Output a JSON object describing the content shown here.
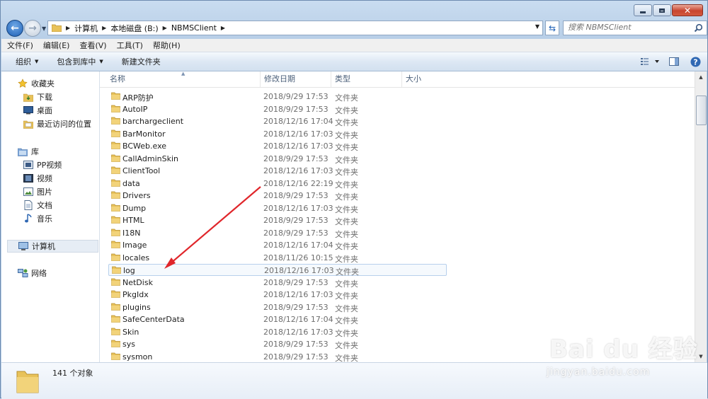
{
  "window": {
    "caption_buttons": [
      "minimize",
      "maximize",
      "close"
    ]
  },
  "address_bar": {
    "breadcrumbs": [
      "计算机",
      "本地磁盘 (B:)",
      "NBMSClient"
    ],
    "search_placeholder": "搜索 NBMSClient"
  },
  "menu_bar": {
    "items": [
      "文件(F)",
      "编辑(E)",
      "查看(V)",
      "工具(T)",
      "帮助(H)"
    ]
  },
  "command_bar": {
    "organize": "组织",
    "include_in_library": "包含到库中",
    "new_folder": "新建文件夹"
  },
  "nav_pane": {
    "favorites": {
      "label": "收藏夹",
      "items": [
        "下载",
        "桌面",
        "最近访问的位置"
      ]
    },
    "libraries": {
      "label": "库",
      "items": [
        "PP视频",
        "视频",
        "图片",
        "文档",
        "音乐"
      ]
    },
    "computer": "计算机",
    "network": "网络"
  },
  "file_list": {
    "columns": [
      "名称",
      "修改日期",
      "类型",
      "大小"
    ],
    "rows": [
      {
        "name": "ARP防护",
        "date": "2018/9/29 17:53",
        "type": "文件夹"
      },
      {
        "name": "AutoIP",
        "date": "2018/9/29 17:53",
        "type": "文件夹"
      },
      {
        "name": "barchargeclient",
        "date": "2018/12/16 17:04",
        "type": "文件夹"
      },
      {
        "name": "BarMonitor",
        "date": "2018/12/16 17:03",
        "type": "文件夹"
      },
      {
        "name": "BCWeb.exe",
        "date": "2018/12/16 17:03",
        "type": "文件夹"
      },
      {
        "name": "CallAdminSkin",
        "date": "2018/9/29 17:53",
        "type": "文件夹"
      },
      {
        "name": "ClientTool",
        "date": "2018/12/16 17:03",
        "type": "文件夹"
      },
      {
        "name": "data",
        "date": "2018/12/16 22:19",
        "type": "文件夹"
      },
      {
        "name": "Drivers",
        "date": "2018/9/29 17:53",
        "type": "文件夹"
      },
      {
        "name": "Dump",
        "date": "2018/12/16 17:03",
        "type": "文件夹"
      },
      {
        "name": "HTML",
        "date": "2018/9/29 17:53",
        "type": "文件夹"
      },
      {
        "name": "I18N",
        "date": "2018/9/29 17:53",
        "type": "文件夹"
      },
      {
        "name": "Image",
        "date": "2018/12/16 17:04",
        "type": "文件夹"
      },
      {
        "name": "locales",
        "date": "2018/11/26 10:15",
        "type": "文件夹"
      },
      {
        "name": "log",
        "date": "2018/12/16 17:03",
        "type": "文件夹"
      },
      {
        "name": "NetDisk",
        "date": "2018/9/29 17:53",
        "type": "文件夹"
      },
      {
        "name": "PkgIdx",
        "date": "2018/12/16 17:03",
        "type": "文件夹"
      },
      {
        "name": "plugins",
        "date": "2018/9/29 17:53",
        "type": "文件夹"
      },
      {
        "name": "SafeCenterData",
        "date": "2018/12/16 17:04",
        "type": "文件夹"
      },
      {
        "name": "Skin",
        "date": "2018/12/16 17:03",
        "type": "文件夹"
      },
      {
        "name": "sys",
        "date": "2018/9/29 17:53",
        "type": "文件夹"
      },
      {
        "name": "sysmon",
        "date": "2018/9/29 17:53",
        "type": "文件夹"
      }
    ],
    "highlighted_row": "log"
  },
  "status": {
    "object_count": "141 个对象"
  },
  "watermark": {
    "logo_text": "Bai du 经验",
    "url": "jingyan.baidu.com"
  },
  "colors": {
    "annotation_arrow": "#e0262b",
    "folder": "#e8c25a",
    "window_frame": "#b6cde6"
  }
}
